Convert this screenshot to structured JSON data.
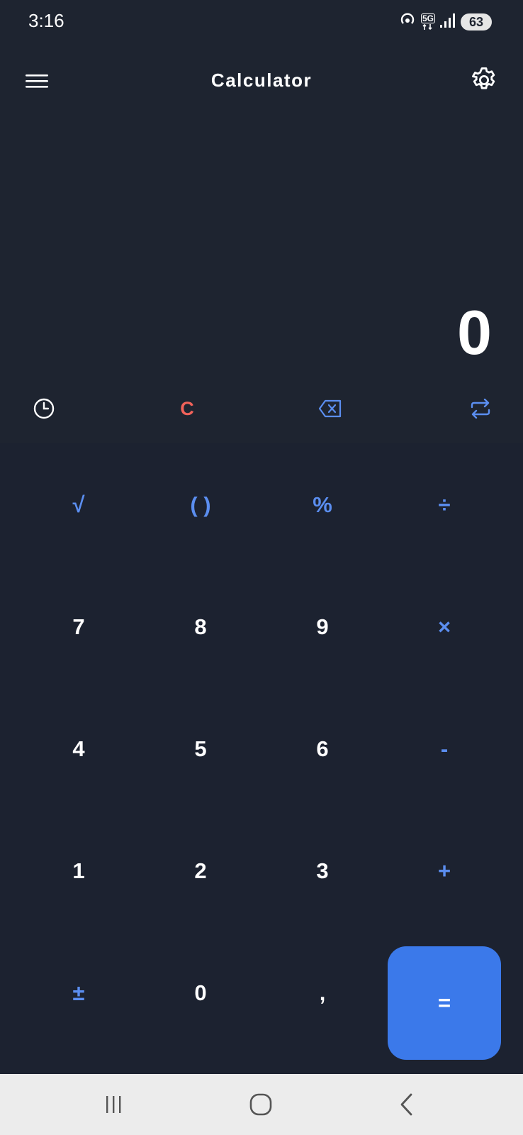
{
  "status_bar": {
    "time": "3:16",
    "network": "5G",
    "battery": "63",
    "icons": [
      "hotspot-icon",
      "network-5g-icon",
      "signal-icon",
      "battery-icon"
    ]
  },
  "app_bar": {
    "title": "Calculator",
    "menu_icon": "hamburger-menu-icon",
    "settings_icon": "gear-icon"
  },
  "display": {
    "value": "0"
  },
  "utility_row": {
    "history_icon": "clock-icon",
    "clear_label": "C",
    "backspace_icon": "backspace-icon",
    "convert_icon": "swap-arrows-icon"
  },
  "keypad": {
    "rows": [
      [
        {
          "label": "√",
          "name": "key-square-root",
          "type": "op"
        },
        {
          "label": "( )",
          "name": "key-parentheses",
          "type": "op"
        },
        {
          "label": "%",
          "name": "key-percent",
          "type": "op"
        },
        {
          "label": "÷",
          "name": "key-divide",
          "type": "op"
        }
      ],
      [
        {
          "label": "7",
          "name": "key-7",
          "type": "num"
        },
        {
          "label": "8",
          "name": "key-8",
          "type": "num"
        },
        {
          "label": "9",
          "name": "key-9",
          "type": "num"
        },
        {
          "label": "×",
          "name": "key-multiply",
          "type": "op"
        }
      ],
      [
        {
          "label": "4",
          "name": "key-4",
          "type": "num"
        },
        {
          "label": "5",
          "name": "key-5",
          "type": "num"
        },
        {
          "label": "6",
          "name": "key-6",
          "type": "num"
        },
        {
          "label": "-",
          "name": "key-subtract",
          "type": "op"
        }
      ],
      [
        {
          "label": "1",
          "name": "key-1",
          "type": "num"
        },
        {
          "label": "2",
          "name": "key-2",
          "type": "num"
        },
        {
          "label": "3",
          "name": "key-3",
          "type": "num"
        },
        {
          "label": "+",
          "name": "key-add",
          "type": "op"
        }
      ],
      [
        {
          "label": "±",
          "name": "key-plus-minus",
          "type": "op"
        },
        {
          "label": "0",
          "name": "key-0",
          "type": "num"
        },
        {
          "label": ",",
          "name": "key-decimal",
          "type": "num"
        },
        {
          "label": "=",
          "name": "key-equals",
          "type": "equals"
        }
      ]
    ]
  },
  "nav_bar": {
    "recents_icon": "recents-icon",
    "home_icon": "home-icon",
    "back_icon": "back-icon"
  },
  "colors": {
    "background": "#1e2430",
    "accent": "#5b8ef0",
    "equals_bg": "#3b79ea",
    "clear": "#f0625a"
  }
}
